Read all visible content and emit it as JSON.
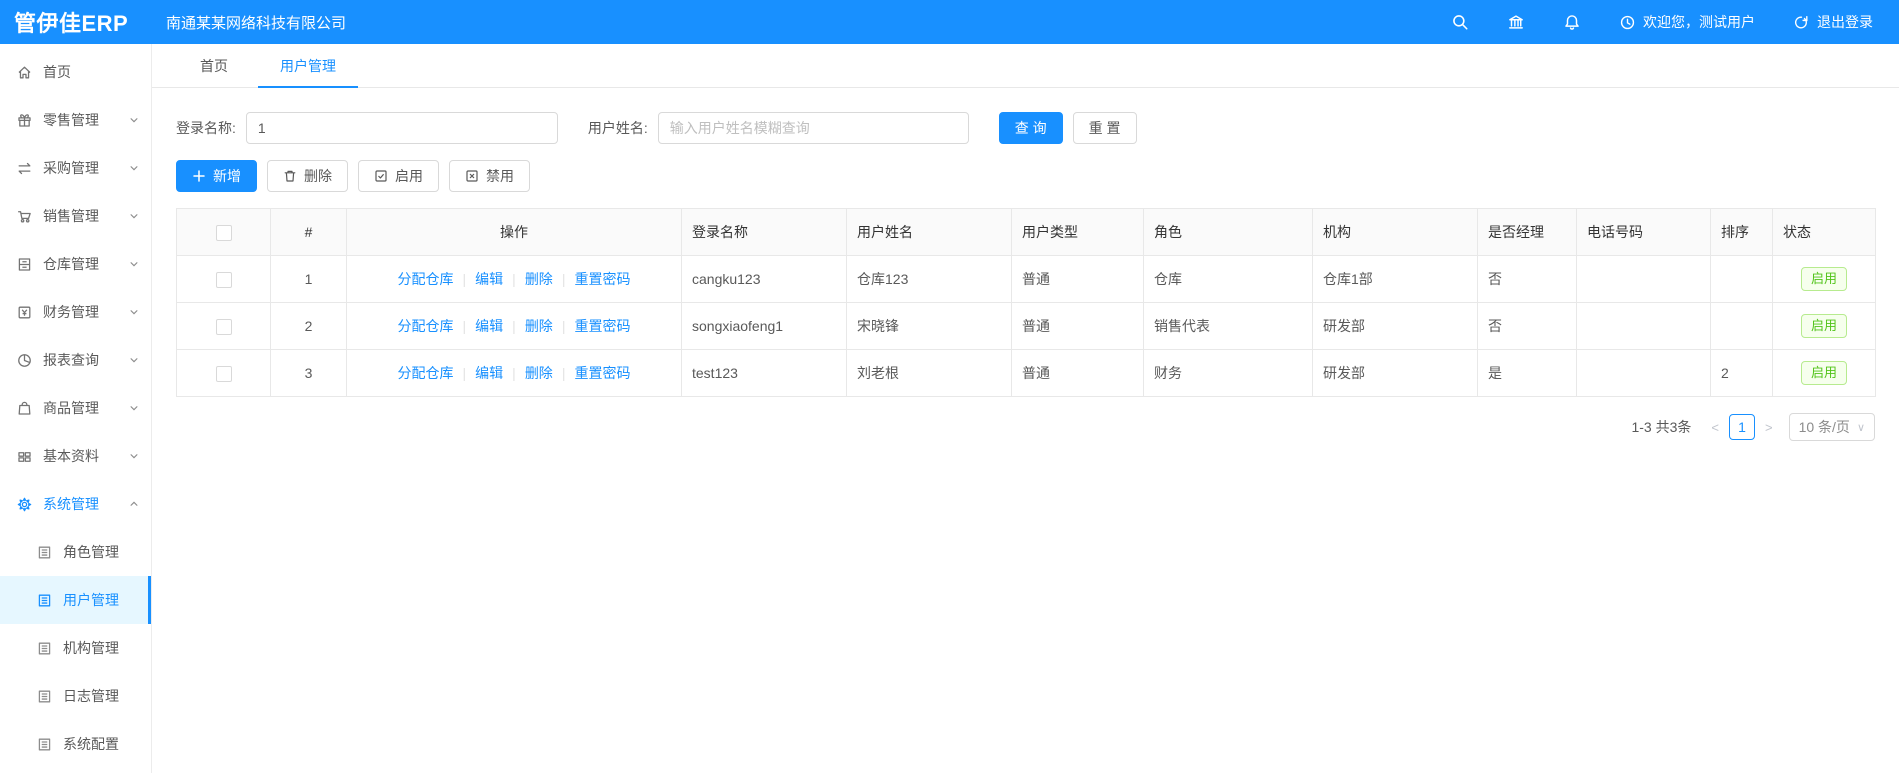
{
  "header": {
    "logo": "管伊佳ERP",
    "company": "南通某某网络科技有限公司",
    "welcome": "欢迎您，测试用户",
    "logout": "退出登录"
  },
  "sidebar": {
    "items": [
      {
        "label": "首页",
        "icon": "home-icon"
      },
      {
        "label": "零售管理",
        "icon": "retail-icon"
      },
      {
        "label": "采购管理",
        "icon": "purchase-icon"
      },
      {
        "label": "销售管理",
        "icon": "sales-icon"
      },
      {
        "label": "仓库管理",
        "icon": "warehouse-icon"
      },
      {
        "label": "财务管理",
        "icon": "finance-icon"
      },
      {
        "label": "报表查询",
        "icon": "report-icon"
      },
      {
        "label": "商品管理",
        "icon": "goods-icon"
      },
      {
        "label": "基本资料",
        "icon": "basic-data-icon"
      },
      {
        "label": "系统管理",
        "icon": "gear-icon"
      }
    ],
    "system_children": [
      {
        "label": "角色管理"
      },
      {
        "label": "用户管理"
      },
      {
        "label": "机构管理"
      },
      {
        "label": "日志管理"
      },
      {
        "label": "系统配置"
      }
    ]
  },
  "tabs": [
    {
      "label": "首页"
    },
    {
      "label": "用户管理"
    }
  ],
  "filters": {
    "login_name_label": "登录名称:",
    "login_name_value": "1",
    "user_name_label": "用户姓名:",
    "user_name_placeholder": "输入用户姓名模糊查询",
    "search_label": "查 询",
    "reset_label": "重 置"
  },
  "toolbar": {
    "add": "新增",
    "delete": "删除",
    "enable": "启用",
    "disable": "禁用"
  },
  "table": {
    "headers": [
      "#",
      "操作",
      "登录名称",
      "用户姓名",
      "用户类型",
      "角色",
      "机构",
      "是否经理",
      "电话号码",
      "排序",
      "状态"
    ],
    "op_labels": [
      "分配仓库",
      "编辑",
      "删除",
      "重置密码"
    ],
    "rows": [
      {
        "index": "1",
        "login_name": "cangku123",
        "user_name": "仓库123",
        "user_type": "普通",
        "role": "仓库",
        "org": "仓库1部",
        "is_manager": "否",
        "phone": "",
        "sort": "",
        "status": "启用"
      },
      {
        "index": "2",
        "login_name": "songxiaofeng1",
        "user_name": "宋晓锋",
        "user_type": "普通",
        "role": "销售代表",
        "org": "研发部",
        "is_manager": "否",
        "phone": "",
        "sort": "",
        "status": "启用"
      },
      {
        "index": "3",
        "login_name": "test123",
        "user_name": "刘老根",
        "user_type": "普通",
        "role": "财务",
        "org": "研发部",
        "is_manager": "是",
        "phone": "",
        "sort": "2",
        "status": "启用"
      }
    ]
  },
  "pagination": {
    "total": "1-3 共3条",
    "prev": "<",
    "page": "1",
    "next": ">",
    "page_size": "10 条/页",
    "caret": "∨"
  },
  "colors": {
    "primary": "#1890ff",
    "success": "#52c41a"
  }
}
